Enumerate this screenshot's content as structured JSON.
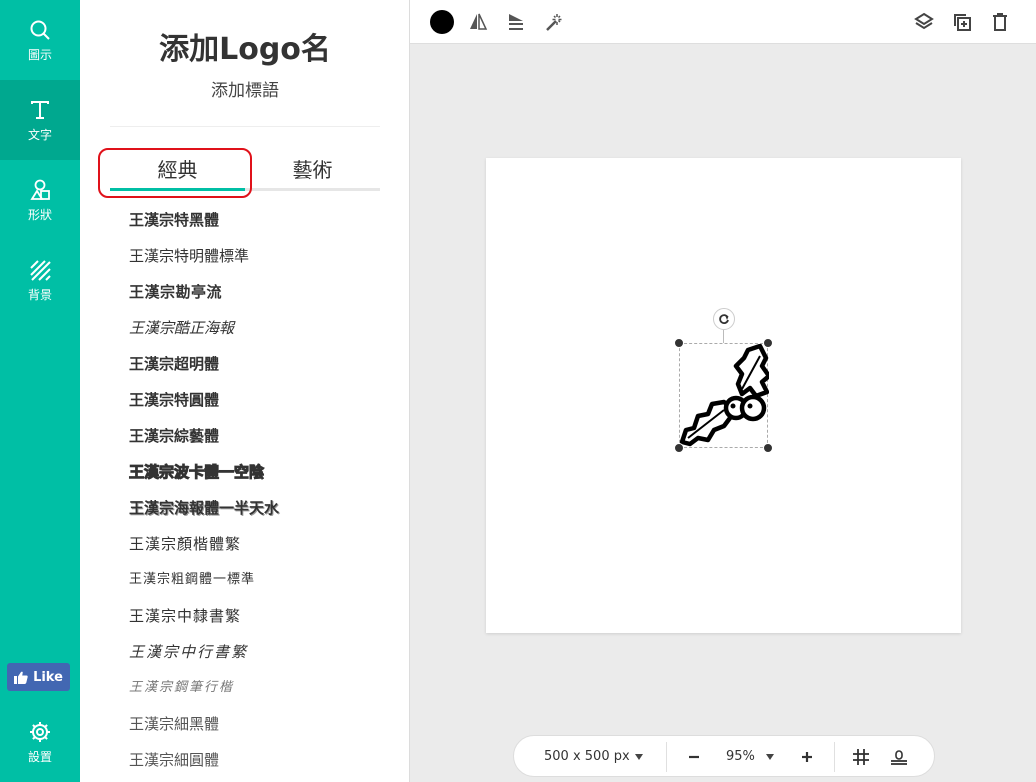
{
  "rail": {
    "items": [
      {
        "label": "圖示",
        "icon": "search-icon"
      },
      {
        "label": "文字",
        "icon": "text-icon"
      },
      {
        "label": "形狀",
        "icon": "shapes-icon"
      },
      {
        "label": "背景",
        "icon": "background-pattern-icon"
      }
    ],
    "facebook_like": "Like",
    "settings_label": "設置"
  },
  "panel": {
    "logo_name": "添加Logo名",
    "slogan": "添加標語",
    "tabs": [
      {
        "label": "經典",
        "active": true
      },
      {
        "label": "藝術",
        "active": false
      }
    ],
    "fonts": [
      "王漢宗特黑體",
      "王漢宗特明體標準",
      "王漢宗勘亭流",
      "王漢宗酷正海報",
      "王漢宗超明體",
      "王漢宗特圓體",
      "王漢宗綜藝體",
      "王漢宗波卡體一空陰",
      "王漢宗海報體一半天水",
      "王漢宗顏楷體繁",
      "王漢宗粗鋼體一標準",
      "王漢宗中隸書繁",
      "王漢宗中行書繁",
      "王漢宗鋼筆行楷",
      "王漢宗細黑體",
      "王漢宗細圓體"
    ]
  },
  "toolbar": {
    "color": "#000000",
    "tools": [
      "flip-icon",
      "align-icon",
      "magic-wand-icon",
      "layers-icon",
      "duplicate-icon",
      "delete-icon"
    ]
  },
  "canvas": {
    "icon": "holly-berry-icon"
  },
  "bottom_bar": {
    "size": "500 x 500 px",
    "zoom": "95%"
  },
  "colors": {
    "accent": "#00bfa5",
    "accent_dark": "#00a88f",
    "facebook": "#4267b2",
    "highlight": "#e0111a"
  }
}
